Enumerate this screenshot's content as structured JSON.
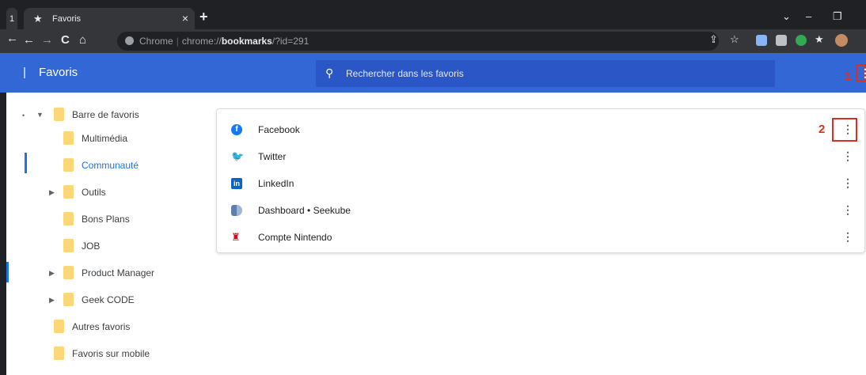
{
  "tab": {
    "stub_label": "1",
    "title": "Favoris",
    "close": "×",
    "new_tab": "+"
  },
  "window_controls": {
    "chevron": "⌄",
    "minimize": "–",
    "restore": "❐"
  },
  "toolbar": {
    "back": "←",
    "forward": "→",
    "reload": "C",
    "home": "⌂",
    "url_prefix": "Chrome",
    "url_scheme": "chrome://",
    "url_host": "bookmarks",
    "url_path": "/?id=291"
  },
  "header": {
    "title": "Favoris",
    "search_placeholder": "Rechercher dans les favoris",
    "marker_1": "1"
  },
  "tree": [
    {
      "label": "Barre de favoris"
    },
    {
      "label": "Multimédia"
    },
    {
      "label": "Communauté"
    },
    {
      "label": "Outils"
    },
    {
      "label": "Bons Plans"
    },
    {
      "label": "JOB"
    },
    {
      "label": "Product Manager"
    },
    {
      "label": "Geek CODE"
    },
    {
      "label": "Autres favoris"
    },
    {
      "label": "Favoris sur mobile"
    }
  ],
  "bookmarks": [
    {
      "label": "Facebook",
      "icon": "facebook-icon"
    },
    {
      "label": "Twitter",
      "icon": "twitter-icon"
    },
    {
      "label": "LinkedIn",
      "icon": "linkedin-icon"
    },
    {
      "label": "Dashboard • Seekube",
      "icon": "seekube-icon"
    },
    {
      "label": "Compte Nintendo",
      "icon": "nintendo-icon"
    }
  ],
  "marker_2": "2",
  "colors": {
    "header_blue": "#3367d6",
    "accent": "#1a73e8",
    "folder": "#fbd777",
    "annotation_red": "#d93025"
  }
}
